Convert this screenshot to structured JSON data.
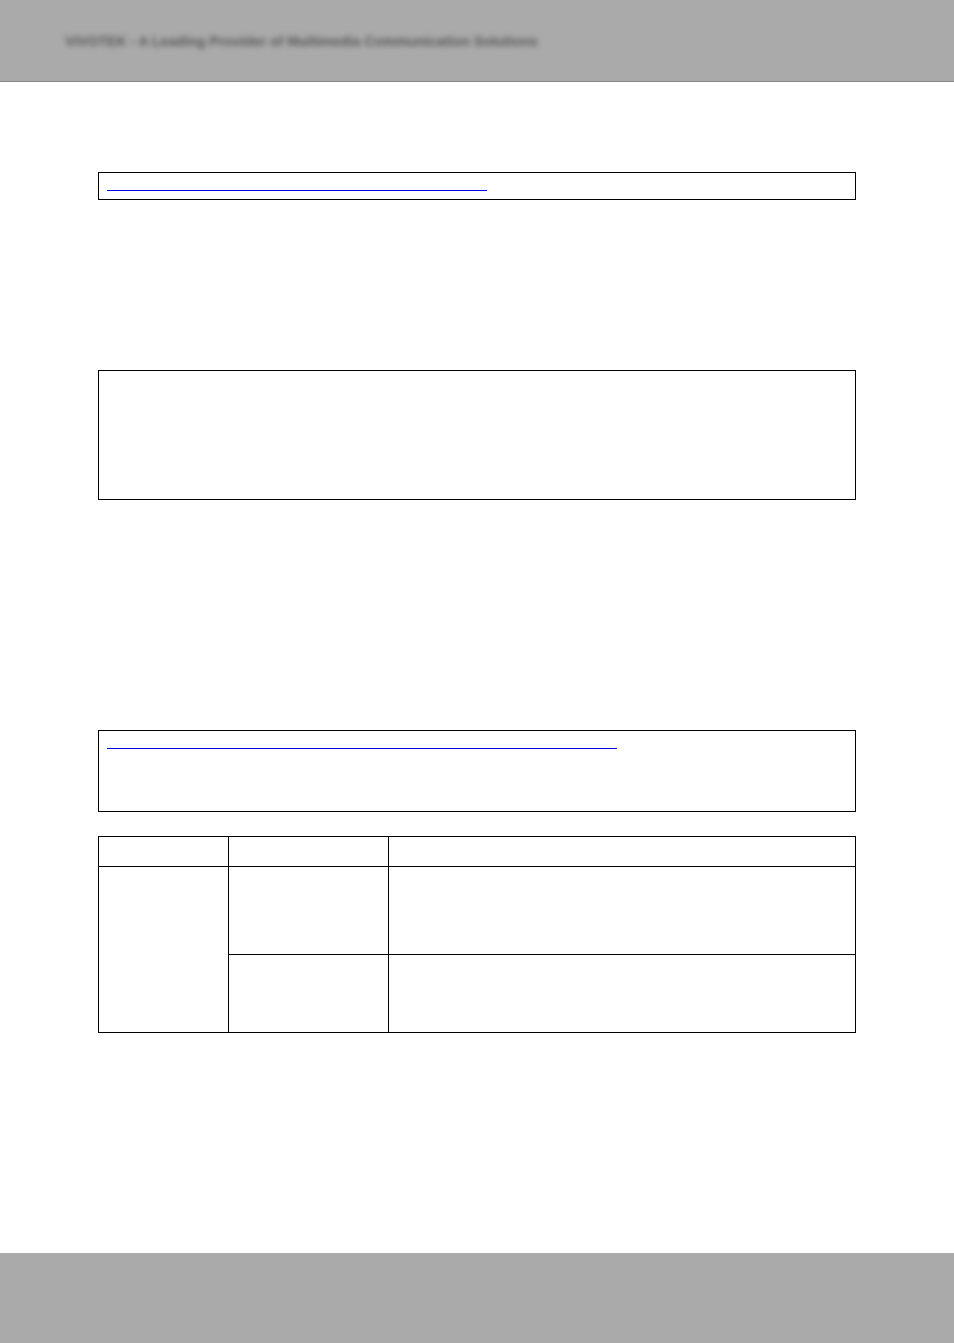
{
  "header": {
    "title": "VIVOTEK - A Leading Provider of Multimedia Communication Solutions"
  },
  "box1": {
    "link_text": ""
  },
  "box2": {},
  "box3": {
    "link_text": ""
  },
  "table": {
    "headers": [
      "",
      "",
      ""
    ],
    "rows": [
      {
        "col1": "",
        "col2": "",
        "col3": ""
      },
      {
        "col1": "",
        "col2": "",
        "col3": ""
      }
    ]
  }
}
